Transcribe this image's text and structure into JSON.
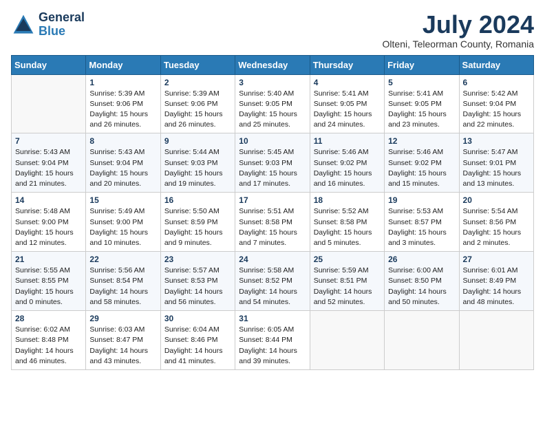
{
  "header": {
    "logo_general": "General",
    "logo_blue": "Blue",
    "month_year": "July 2024",
    "location": "Olteni, Teleorman County, Romania"
  },
  "weekdays": [
    "Sunday",
    "Monday",
    "Tuesday",
    "Wednesday",
    "Thursday",
    "Friday",
    "Saturday"
  ],
  "weeks": [
    [
      {
        "day": "",
        "info": ""
      },
      {
        "day": "1",
        "info": "Sunrise: 5:39 AM\nSunset: 9:06 PM\nDaylight: 15 hours\nand 26 minutes."
      },
      {
        "day": "2",
        "info": "Sunrise: 5:39 AM\nSunset: 9:06 PM\nDaylight: 15 hours\nand 26 minutes."
      },
      {
        "day": "3",
        "info": "Sunrise: 5:40 AM\nSunset: 9:05 PM\nDaylight: 15 hours\nand 25 minutes."
      },
      {
        "day": "4",
        "info": "Sunrise: 5:41 AM\nSunset: 9:05 PM\nDaylight: 15 hours\nand 24 minutes."
      },
      {
        "day": "5",
        "info": "Sunrise: 5:41 AM\nSunset: 9:05 PM\nDaylight: 15 hours\nand 23 minutes."
      },
      {
        "day": "6",
        "info": "Sunrise: 5:42 AM\nSunset: 9:04 PM\nDaylight: 15 hours\nand 22 minutes."
      }
    ],
    [
      {
        "day": "7",
        "info": "Sunrise: 5:43 AM\nSunset: 9:04 PM\nDaylight: 15 hours\nand 21 minutes."
      },
      {
        "day": "8",
        "info": "Sunrise: 5:43 AM\nSunset: 9:04 PM\nDaylight: 15 hours\nand 20 minutes."
      },
      {
        "day": "9",
        "info": "Sunrise: 5:44 AM\nSunset: 9:03 PM\nDaylight: 15 hours\nand 19 minutes."
      },
      {
        "day": "10",
        "info": "Sunrise: 5:45 AM\nSunset: 9:03 PM\nDaylight: 15 hours\nand 17 minutes."
      },
      {
        "day": "11",
        "info": "Sunrise: 5:46 AM\nSunset: 9:02 PM\nDaylight: 15 hours\nand 16 minutes."
      },
      {
        "day": "12",
        "info": "Sunrise: 5:46 AM\nSunset: 9:02 PM\nDaylight: 15 hours\nand 15 minutes."
      },
      {
        "day": "13",
        "info": "Sunrise: 5:47 AM\nSunset: 9:01 PM\nDaylight: 15 hours\nand 13 minutes."
      }
    ],
    [
      {
        "day": "14",
        "info": "Sunrise: 5:48 AM\nSunset: 9:00 PM\nDaylight: 15 hours\nand 12 minutes."
      },
      {
        "day": "15",
        "info": "Sunrise: 5:49 AM\nSunset: 9:00 PM\nDaylight: 15 hours\nand 10 minutes."
      },
      {
        "day": "16",
        "info": "Sunrise: 5:50 AM\nSunset: 8:59 PM\nDaylight: 15 hours\nand 9 minutes."
      },
      {
        "day": "17",
        "info": "Sunrise: 5:51 AM\nSunset: 8:58 PM\nDaylight: 15 hours\nand 7 minutes."
      },
      {
        "day": "18",
        "info": "Sunrise: 5:52 AM\nSunset: 8:58 PM\nDaylight: 15 hours\nand 5 minutes."
      },
      {
        "day": "19",
        "info": "Sunrise: 5:53 AM\nSunset: 8:57 PM\nDaylight: 15 hours\nand 3 minutes."
      },
      {
        "day": "20",
        "info": "Sunrise: 5:54 AM\nSunset: 8:56 PM\nDaylight: 15 hours\nand 2 minutes."
      }
    ],
    [
      {
        "day": "21",
        "info": "Sunrise: 5:55 AM\nSunset: 8:55 PM\nDaylight: 15 hours\nand 0 minutes."
      },
      {
        "day": "22",
        "info": "Sunrise: 5:56 AM\nSunset: 8:54 PM\nDaylight: 14 hours\nand 58 minutes."
      },
      {
        "day": "23",
        "info": "Sunrise: 5:57 AM\nSunset: 8:53 PM\nDaylight: 14 hours\nand 56 minutes."
      },
      {
        "day": "24",
        "info": "Sunrise: 5:58 AM\nSunset: 8:52 PM\nDaylight: 14 hours\nand 54 minutes."
      },
      {
        "day": "25",
        "info": "Sunrise: 5:59 AM\nSunset: 8:51 PM\nDaylight: 14 hours\nand 52 minutes."
      },
      {
        "day": "26",
        "info": "Sunrise: 6:00 AM\nSunset: 8:50 PM\nDaylight: 14 hours\nand 50 minutes."
      },
      {
        "day": "27",
        "info": "Sunrise: 6:01 AM\nSunset: 8:49 PM\nDaylight: 14 hours\nand 48 minutes."
      }
    ],
    [
      {
        "day": "28",
        "info": "Sunrise: 6:02 AM\nSunset: 8:48 PM\nDaylight: 14 hours\nand 46 minutes."
      },
      {
        "day": "29",
        "info": "Sunrise: 6:03 AM\nSunset: 8:47 PM\nDaylight: 14 hours\nand 43 minutes."
      },
      {
        "day": "30",
        "info": "Sunrise: 6:04 AM\nSunset: 8:46 PM\nDaylight: 14 hours\nand 41 minutes."
      },
      {
        "day": "31",
        "info": "Sunrise: 6:05 AM\nSunset: 8:44 PM\nDaylight: 14 hours\nand 39 minutes."
      },
      {
        "day": "",
        "info": ""
      },
      {
        "day": "",
        "info": ""
      },
      {
        "day": "",
        "info": ""
      }
    ]
  ]
}
